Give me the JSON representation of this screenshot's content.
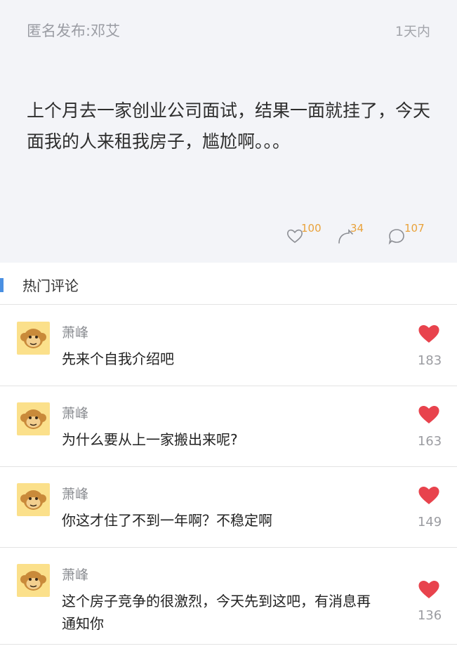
{
  "post": {
    "author": "匿名发布:邓艾",
    "time": "1天内",
    "content": "上个月去一家创业公司面试，结果一面就挂了，今天面我的人来租我房子，尴尬啊。。。",
    "stats": {
      "likes": "100",
      "shares": "34",
      "comments": "107"
    }
  },
  "section": {
    "title": "热门评论"
  },
  "comments": [
    {
      "name": "萧峰",
      "text": "先来个自我介绍吧",
      "likes": "183"
    },
    {
      "name": "萧峰",
      "text": "为什么要从上一家搬出来呢?",
      "likes": "163"
    },
    {
      "name": "萧峰",
      "text": "你这才住了不到一年啊？不稳定啊",
      "likes": "149"
    },
    {
      "name": "萧峰",
      "text": "这个房子竞争的很激烈，今天先到这吧，有消息再通知你",
      "likes": "136"
    }
  ],
  "colors": {
    "accent": "#4a90e2",
    "heart": "#e8434d",
    "count": "#e9a23b",
    "avatar_bg": "#fbe08b"
  }
}
